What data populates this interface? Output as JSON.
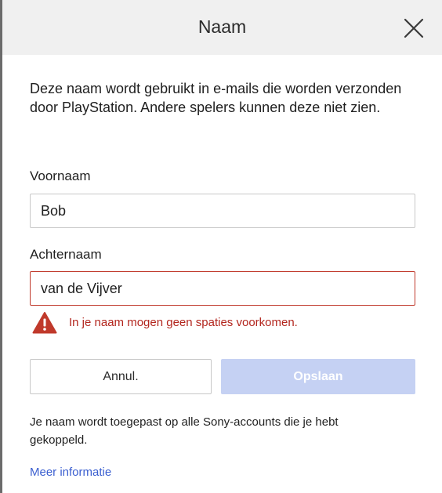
{
  "dialog": {
    "title": "Naam",
    "close_icon": "close-icon",
    "intro": "Deze naam wordt gebruikt in e-mails die worden verzonden door PlayStation. Andere spelers kunnen deze niet zien."
  },
  "form": {
    "first_name": {
      "label": "Voornaam",
      "value": "Bob"
    },
    "last_name": {
      "label": "Achternaam",
      "value": "van de Vijver"
    },
    "error": {
      "icon": "warning-icon",
      "message": "In je naam mogen geen spaties voorkomen."
    }
  },
  "buttons": {
    "cancel_label": "Annul.",
    "save_label": "Opslaan"
  },
  "footer": {
    "note": "Je naam wordt toegepast op alle Sony-accounts die je hebt gekoppeld.",
    "link_label": "Meer informatie"
  },
  "colors": {
    "header_bg": "#f0f0f0",
    "error": "#b3261e",
    "error_border": "#c0392b",
    "save_disabled_bg": "#c5d1f3",
    "link": "#3b5fd0"
  }
}
